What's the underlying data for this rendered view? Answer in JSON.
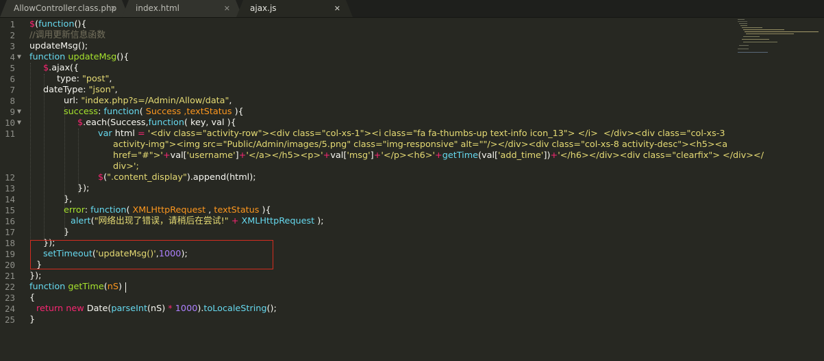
{
  "tabs": [
    {
      "label": "AllowController.class.php",
      "close": "✕",
      "active": false
    },
    {
      "label": "index.html",
      "close": "✕",
      "active": false
    },
    {
      "label": "ajax.js",
      "close": "✕",
      "active": true
    }
  ],
  "line_numbers": [
    "1",
    "2",
    "3",
    "4",
    "5",
    "6",
    "7",
    "8",
    "9",
    "10",
    "11",
    "12",
    "13",
    "14",
    "15",
    "16",
    "17",
    "18",
    "19",
    "20",
    "21",
    "22",
    "23",
    "24",
    "25"
  ],
  "colors": {
    "keyword": "#f92672",
    "function": "#66d9ef",
    "name": "#a6e22e",
    "string": "#e6db74",
    "comment": "#75715e",
    "param": "#fd971f",
    "number": "#ae81ff",
    "highlight_box": "#d62d20"
  },
  "icons": {
    "fold": "fold-arrow-icon",
    "close": "close-icon"
  },
  "code": {
    "l1": [
      "$",
      "(",
      "function",
      "(){"
    ],
    "l2": "//调用更新信息函数",
    "l3": "updateMsg();",
    "l4": [
      "function",
      " ",
      "updateMsg",
      "(){"
    ],
    "l5": [
      "$",
      ".ajax({"
    ],
    "l6": [
      "type: ",
      "\"post\"",
      ","
    ],
    "l7": [
      "dateType: ",
      "\"json\"",
      ","
    ],
    "l8": [
      "url: ",
      "\"index.php?s=/Admin/Allow/data\"",
      ","
    ],
    "l9": [
      "success",
      ": ",
      "function",
      "( ",
      "Success",
      " ,",
      "textStatus",
      " ){"
    ],
    "l10": [
      "$",
      ".each(Success,",
      "function",
      "( key, val ){"
    ],
    "l11a": [
      "var",
      " html ",
      "=",
      " '",
      "<div class=\"activity-row\"><div class=\"col-xs-1\"><i class=\"fa fa-thumbs-up text-info icon_13\"> </i>  </div><div class=\"col-xs-3"
    ],
    "l11b": "activity-img\"><img src=\"Public/Admin/images/5.png\" class=\"img-responsive\" alt=\"\"/></div><div class=\"col-xs-8 activity-desc\"><h5><a",
    "l11c": [
      "href=\"#\">'",
      "+",
      "val[",
      "'username'",
      "]",
      "+",
      "'</a></h5><p>'",
      "+",
      "val[",
      "'msg'",
      "]",
      "+",
      "'</p><h6>'",
      "+",
      "getTime",
      "(val[",
      "'add_time'",
      "])",
      "+",
      "'</h6></div><div class=\"clearfix\"> </div></"
    ],
    "l11d": "div>';",
    "l12": [
      "$",
      "(",
      "\".content_display\"",
      ").append(html);"
    ],
    "l13": "});",
    "l14": "},",
    "l15": [
      "error",
      ": ",
      "function",
      "( ",
      "XMLHttpRequest",
      " , ",
      "textStatus",
      " ){"
    ],
    "l16": [
      "alert",
      "(",
      "\"网络出现了错误，请稍后在尝试!\"",
      " + ",
      "XMLHttpRequest",
      " );"
    ],
    "l17": "}",
    "l18": "});",
    "l19": [
      "setTimeout",
      "(",
      "'updateMsg()'",
      ",",
      "1000",
      ");"
    ],
    "l20": "}",
    "l21": "});",
    "l22": [
      "function",
      " ",
      "getTime",
      "(",
      "nS",
      ")"
    ],
    "l23": "{",
    "l24": [
      "return",
      " ",
      "new",
      " Date(",
      "parseInt",
      "(nS) ",
      "*",
      " ",
      "1000",
      ").",
      "toLocaleString",
      "();"
    ],
    "l25": "}"
  }
}
